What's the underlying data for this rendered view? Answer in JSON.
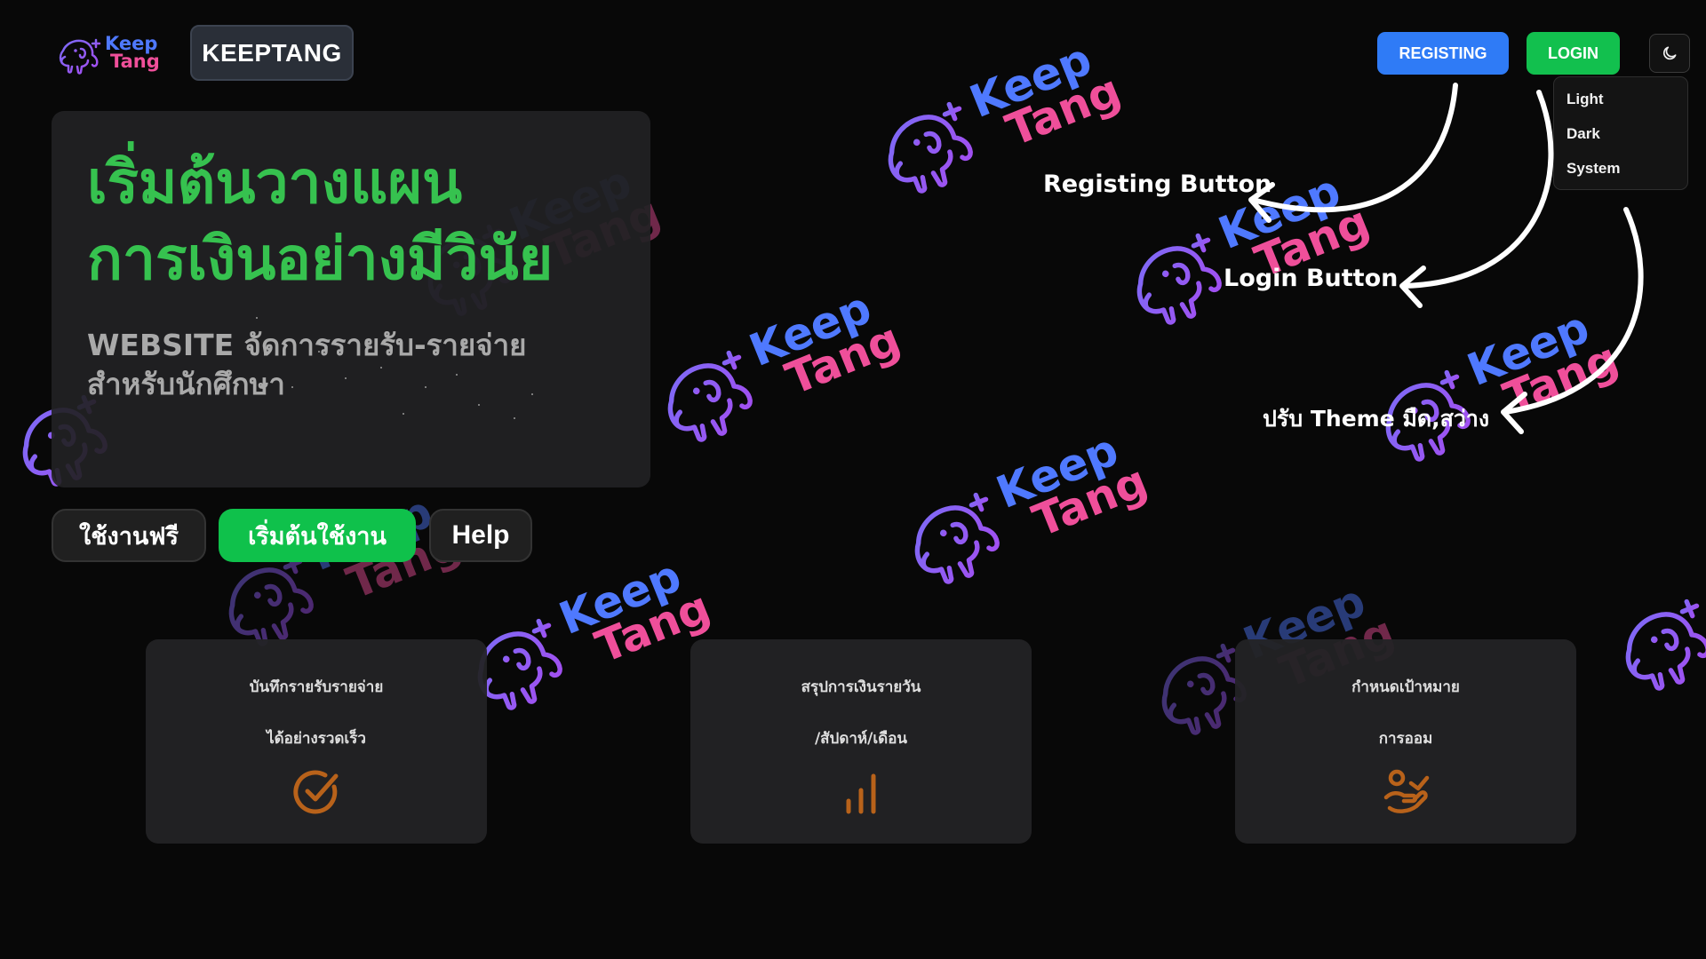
{
  "header": {
    "logo": {
      "keep": "Keep",
      "tang": "Tang"
    },
    "brand_label": "KEEPTANG",
    "registing_label": "REGISTING",
    "login_label": "LOGIN",
    "theme_toggle_icon": "moon-icon",
    "theme_menu": [
      "Light",
      "Dark",
      "System"
    ]
  },
  "hero": {
    "title_lines": [
      "เริ่มต้นวางแผน",
      "การเงินอย่างมีวินัย"
    ],
    "subtitle_lines": [
      "WEBSITE จัดการรายรับ-รายจ่าย",
      "สำหรับนักศึกษา"
    ],
    "buttons": {
      "free": "ใช้งานฟรี",
      "start": "เริ่มต้นใช้งาน",
      "help": "Help"
    }
  },
  "features": [
    {
      "line1": "บันทึกรายรับรายจ่าย",
      "line2": "ได้อย่างรวดเร็ว",
      "icon": "check-circle-icon"
    },
    {
      "line1": "สรุปการเงินรายวัน",
      "line2": "/สัปดาห์/เดือน",
      "icon": "bar-chart-icon"
    },
    {
      "line1": "กำหนดเป้าหมาย",
      "line2": "การออม",
      "icon": "savings-hand-icon"
    }
  ],
  "annotations": {
    "registing": "Registing Button",
    "login": "Login Button",
    "theme": "ปรับ Theme มืด,สว่าง"
  },
  "colors": {
    "background": "#080808",
    "brand_blue": "#4f79ff",
    "brand_pink": "#ef4f9a",
    "elephant_purple": "#8b5cf6",
    "registing_blue": "#2f7bf6",
    "login_green": "#12c04e",
    "hero_green": "#36c24f",
    "feature_icon_orange": "#b8621a"
  }
}
